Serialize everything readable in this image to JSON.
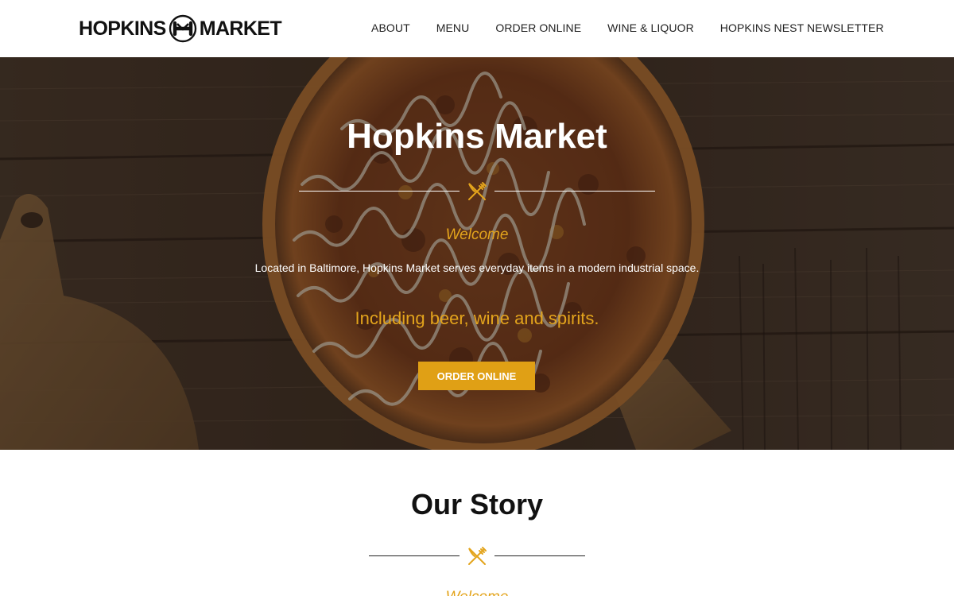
{
  "header": {
    "logo_left": "HOPKINS",
    "logo_right": "MARKET",
    "nav": [
      {
        "label": "ABOUT"
      },
      {
        "label": "MENU"
      },
      {
        "label": "ORDER ONLINE"
      },
      {
        "label": "WINE & LIQUOR"
      },
      {
        "label": "HOPKINS NEST NEWSLETTER"
      }
    ]
  },
  "hero": {
    "title": "Hopkins Market",
    "welcome": "Welcome",
    "description": "Located in Baltimore, Hopkins Market serves everyday items in a modern industrial space.",
    "tagline": "Including beer, wine and spirits.",
    "cta_label": "ORDER ONLINE",
    "divider_icon": "fork-knife-icon"
  },
  "story": {
    "title": "Our Story",
    "divider_icon": "fork-knife-icon",
    "peek_text": "Welcome"
  },
  "colors": {
    "accent": "#e0a015",
    "accent_text": "#e3a41c",
    "header_bg": "#ffffff",
    "text_dark": "#111111"
  }
}
